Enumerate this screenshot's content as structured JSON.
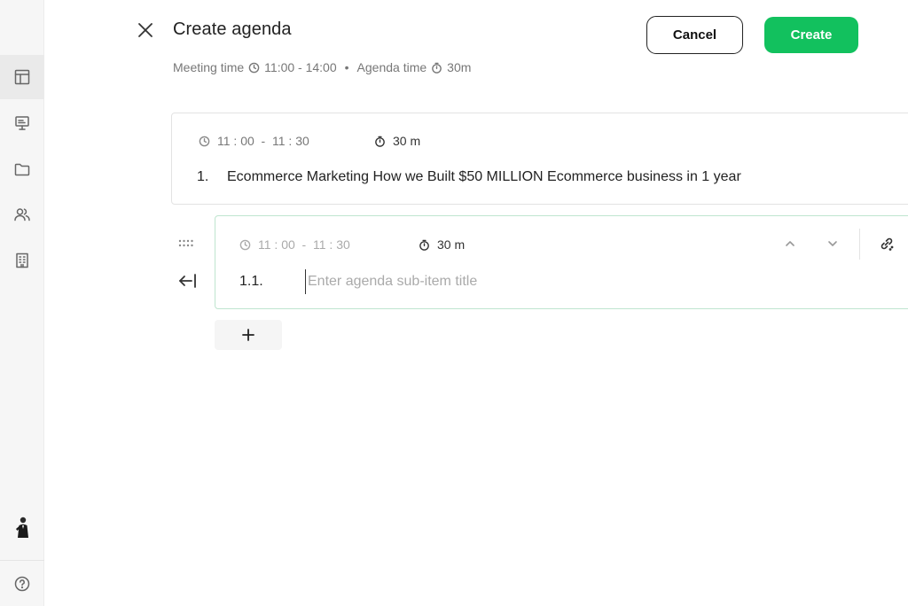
{
  "sidebar": {
    "items": [
      {
        "name": "layout-icon",
        "active": true
      },
      {
        "name": "presentation-icon",
        "active": false
      },
      {
        "name": "folder-icon",
        "active": false
      },
      {
        "name": "users-icon",
        "active": false
      },
      {
        "name": "building-icon",
        "active": false
      }
    ],
    "help_icon": "help-icon"
  },
  "header": {
    "title": "Create agenda",
    "meeting_time_label": "Meeting time",
    "meeting_time_value": "11:00 - 14:00",
    "separator": "•",
    "agenda_time_label": "Agenda time",
    "agenda_time_value": "30m",
    "cancel_label": "Cancel",
    "create_label": "Create"
  },
  "agenda_items": [
    {
      "time_range": "11 : 00  -  11 : 30",
      "duration": "30 m",
      "number": "1.",
      "title": "Ecommerce Marketing How we Built $50 MILLION Ecommerce business in 1 year"
    }
  ],
  "sub_item": {
    "time_range": "11 : 00  -  11 : 30",
    "duration": "30 m",
    "number": "1.1.",
    "placeholder": "Enter agenda sub-item title",
    "value": ""
  },
  "colors": {
    "accent": "#12c15e",
    "active_border": "#bfe5cf"
  }
}
